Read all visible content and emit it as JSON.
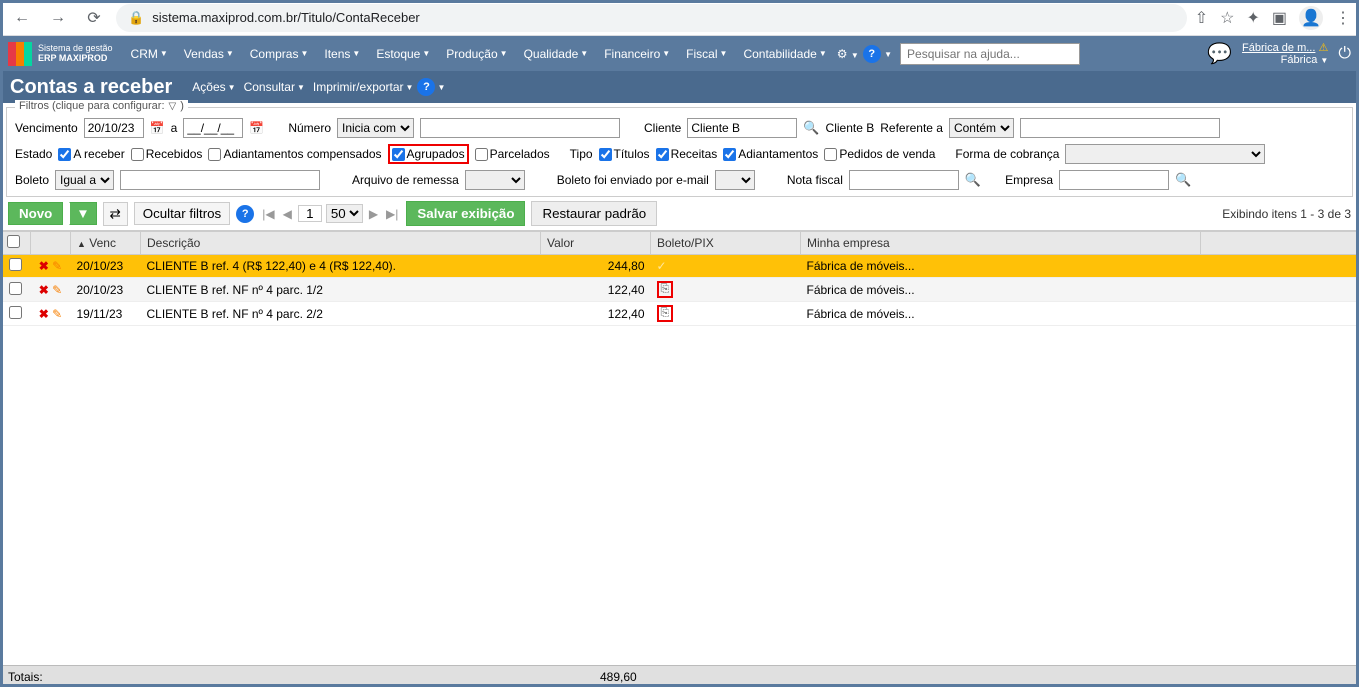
{
  "browser": {
    "url": "sistema.maxiprod.com.br/Titulo/ContaReceber"
  },
  "top_menu": {
    "logo_line1": "Sistema de gestão",
    "logo_line2": "ERP MAXIPROD",
    "items": [
      "CRM",
      "Vendas",
      "Compras",
      "Itens",
      "Estoque",
      "Produção",
      "Qualidade",
      "Financeiro",
      "Fiscal",
      "Contabilidade"
    ],
    "search_placeholder": "Pesquisar na ajuda...",
    "user_link": "Fábrica de m...",
    "user_sub": "Fábrica"
  },
  "page": {
    "title": "Contas a receber",
    "actions": [
      "Ações",
      "Consultar",
      "Imprimir/exportar"
    ]
  },
  "filters": {
    "legend": "Filtros (clique para configurar:",
    "vencimento_label": "Vencimento",
    "vencimento_value": "20/10/23",
    "a_label": "a",
    "date_to": "__/__/__",
    "numero_label": "Número",
    "numero_op": "Inicia com",
    "cliente_label": "Cliente",
    "cliente_value": "Cliente B",
    "cliente_b_label": "Cliente B",
    "referente_label": "Referente a",
    "referente_op": "Contém",
    "estado_label": "Estado",
    "estado_opts": {
      "a_receber": "A receber",
      "recebidos": "Recebidos",
      "adiant_comp": "Adiantamentos compensados",
      "agrupados": "Agrupados",
      "parcelados": "Parcelados"
    },
    "tipo_label": "Tipo",
    "tipo_opts": {
      "titulos": "Títulos",
      "receitas": "Receitas",
      "adiantamentos": "Adiantamentos",
      "pedidos": "Pedidos de venda"
    },
    "forma_label": "Forma de cobrança",
    "boleto_label": "Boleto",
    "boleto_op": "Igual a",
    "arquivo_label": "Arquivo de remessa",
    "email_label": "Boleto foi enviado por e-mail",
    "nota_label": "Nota fiscal",
    "empresa_label": "Empresa"
  },
  "toolbar": {
    "novo": "Novo",
    "ocultar": "Ocultar filtros",
    "page": "1",
    "page_size": "50",
    "save_view": "Salvar exibição",
    "restore": "Restaurar padrão",
    "showing": "Exibindo itens 1 - 3 de 3"
  },
  "grid": {
    "headers": {
      "venc": "Venc",
      "desc": "Descrição",
      "valor": "Valor",
      "boleto": "Boleto/PIX",
      "empresa": "Minha empresa"
    },
    "rows": [
      {
        "venc": "20/10/23",
        "desc": "CLIENTE B ref. 4 (R$ 122,40) e 4 (R$ 122,40).",
        "valor": "244,80",
        "boleto_check": true,
        "empresa": "Fábrica de móveis...",
        "highlight": true
      },
      {
        "venc": "20/10/23",
        "desc": "CLIENTE B ref. NF nº 4 parc. 1/2",
        "valor": "122,40",
        "boleto_copy": true,
        "empresa": "Fábrica de móveis...",
        "alt": true
      },
      {
        "venc": "19/11/23",
        "desc": "CLIENTE B ref. NF nº 4 parc. 2/2",
        "valor": "122,40",
        "boleto_copy": true,
        "empresa": "Fábrica de móveis..."
      }
    ]
  },
  "footer": {
    "totais": "Totais:",
    "total_valor": "489,60"
  }
}
